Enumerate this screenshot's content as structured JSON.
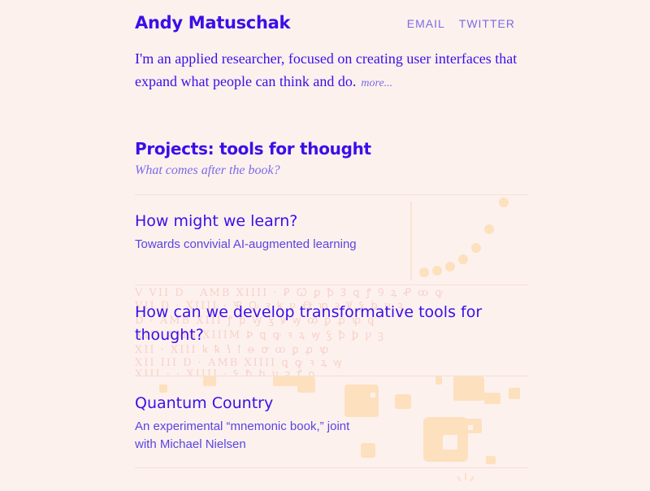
{
  "header": {
    "name": "Andy Matuschak",
    "nav": [
      "EMAIL",
      "TWITTER"
    ]
  },
  "intro": {
    "text": "I'm an applied researcher, focused on creating user interfaces that expand what people can think and do.",
    "more": "more..."
  },
  "section": {
    "title": "Projects: tools for thought",
    "subtitle": "What comes after the book?"
  },
  "projects": [
    {
      "title": "How might we learn?",
      "desc": "Towards convivial AI-augmented learning"
    },
    {
      "title": "How can we develop transformative tools for thought?",
      "desc": ""
    },
    {
      "title": "Quantum Country",
      "desc": "An experimental “mnemonic book,” joint with Michael Nielsen"
    }
  ],
  "colors": {
    "background": "#fdf1ee",
    "accent": "#3a0fe8",
    "muted_accent": "#7a6be6",
    "decor_peach": "#fde0bd",
    "decor_pink": "#f6d2c8"
  }
}
